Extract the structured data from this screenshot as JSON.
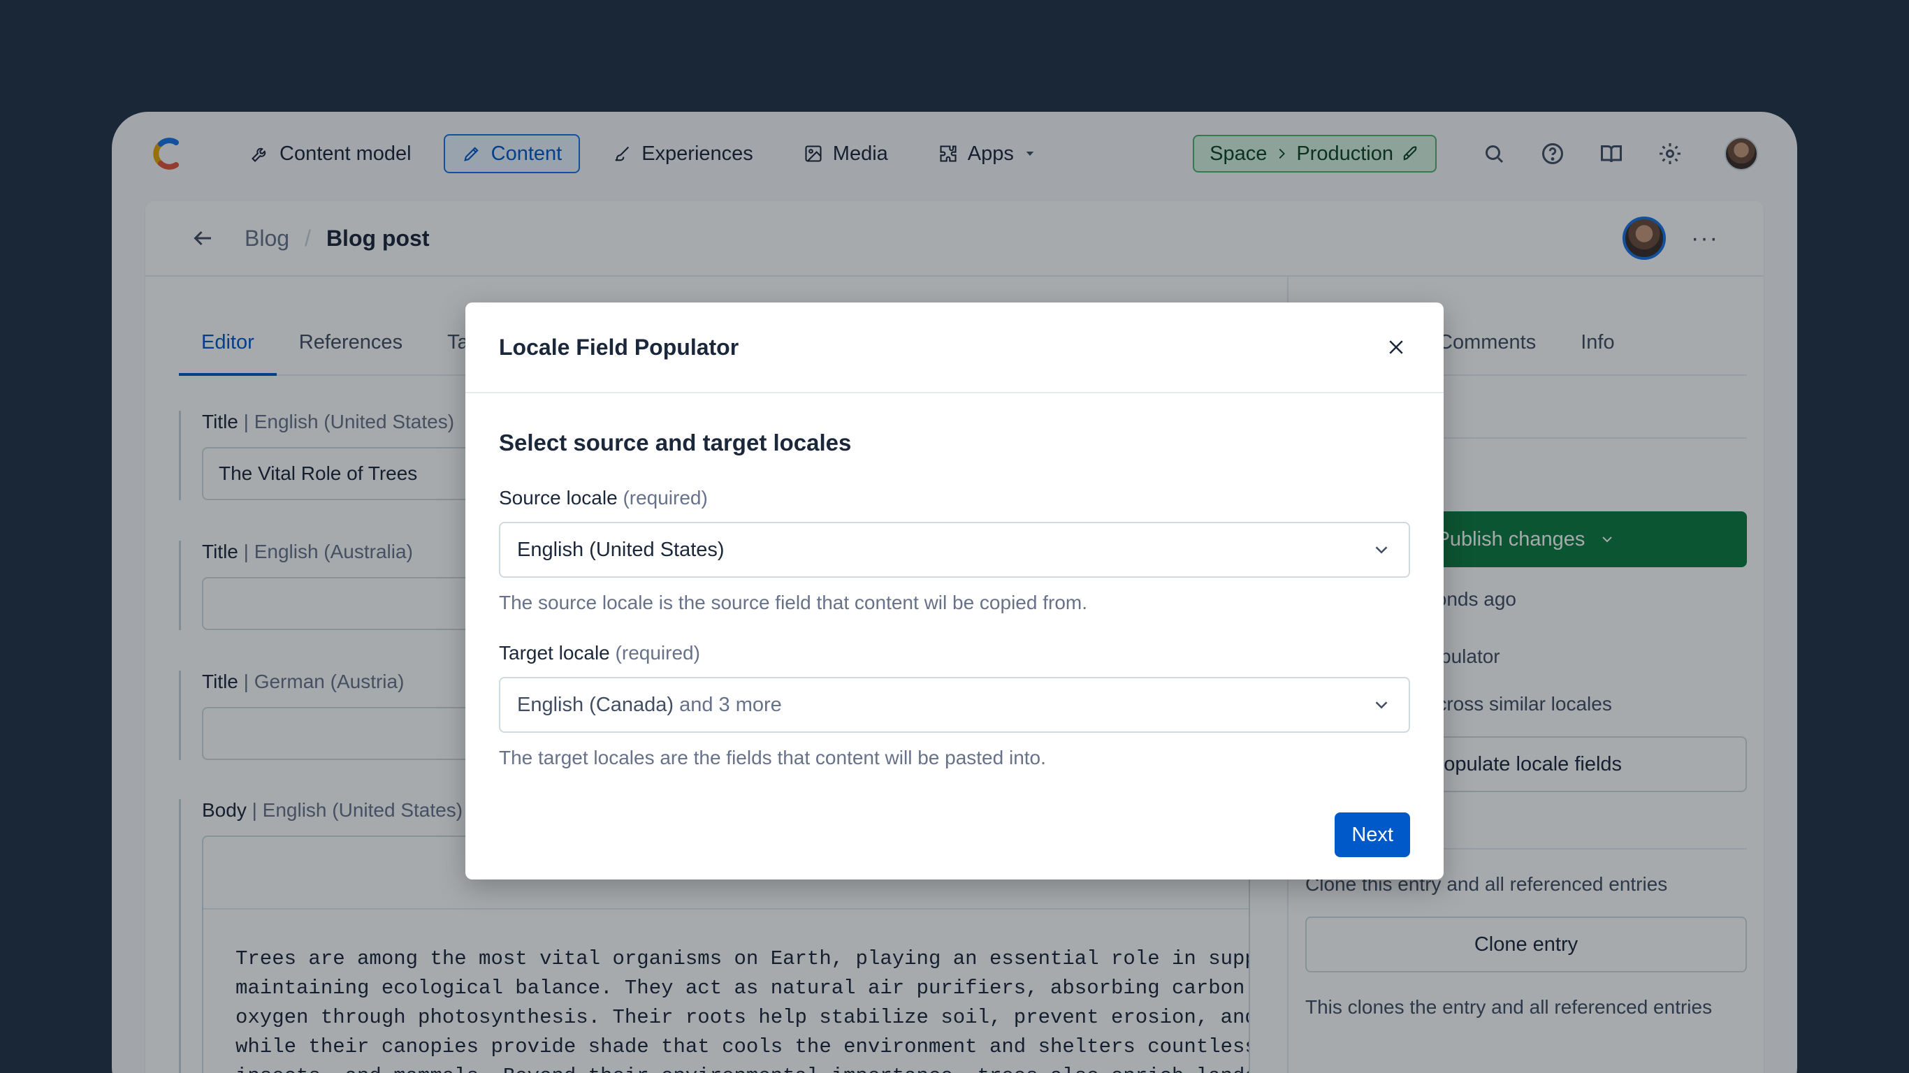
{
  "nav": {
    "items": [
      {
        "label": "Content model",
        "icon": "wrench-icon"
      },
      {
        "label": "Content",
        "icon": "pen-icon",
        "active": true
      },
      {
        "label": "Experiences",
        "icon": "brush-icon"
      },
      {
        "label": "Media",
        "icon": "image-icon"
      },
      {
        "label": "Apps",
        "icon": "puzzle-icon"
      }
    ],
    "space": "Space",
    "environment": "Production"
  },
  "entry": {
    "breadcrumb_parent": "Blog",
    "breadcrumb_current": "Blog post"
  },
  "editor": {
    "tabs": [
      "Editor",
      "References",
      "Tags"
    ],
    "fields": [
      {
        "name": "Title",
        "locale": "| English (United States)",
        "value": "The Vital Role of Trees"
      },
      {
        "name": "Title",
        "locale": "| English (Australia)",
        "value": ""
      },
      {
        "name": "Title",
        "locale": "| German (Austria)",
        "value": ""
      },
      {
        "name": "Body",
        "locale": "| English (United States)"
      }
    ],
    "body_lines": [
      "Trees are among the most vital organisms on Earth, playing an essential role in supporting",
      "maintaining ecological balance. They act as natural air purifiers, absorbing carbon dioxide",
      "oxygen through photosynthesis. Their roots help stabilize soil, prevent erosion, and regulate",
      "while their canopies provide shade that cools the environment and shelters countless species",
      "insects, and mammals. Beyond their environmental importance, trees also enrich landscapes"
    ]
  },
  "sidebar": {
    "tabs": [
      "Comments",
      "Info"
    ],
    "publish_label": "Publish changes",
    "saved_text": "Last saved seconds ago",
    "app_name": "Locale Field Populator",
    "app_desc": "Copy content across similar locales",
    "populate_label": "Populate locale fields",
    "clone_desc": "Clone this entry and all referenced entries",
    "clone_label": "Clone entry",
    "clone_note": "This clones the entry and all referenced entries"
  },
  "modal": {
    "title": "Locale Field Populator",
    "heading": "Select source and target locales",
    "source_label": "Source locale",
    "required_text": "(required)",
    "source_value": "English (United States)",
    "source_help": "The source locale is the source field that content wil be copied from.",
    "target_label": "Target locale",
    "target_value": "English (Canada)",
    "target_more": "and 3 more",
    "target_help": "The target locales are the fields that content will be pasted into.",
    "next_label": "Next"
  },
  "colors": {
    "backdrop": "#223247",
    "primary": "#0059c8",
    "success": "#0d7a3f"
  }
}
